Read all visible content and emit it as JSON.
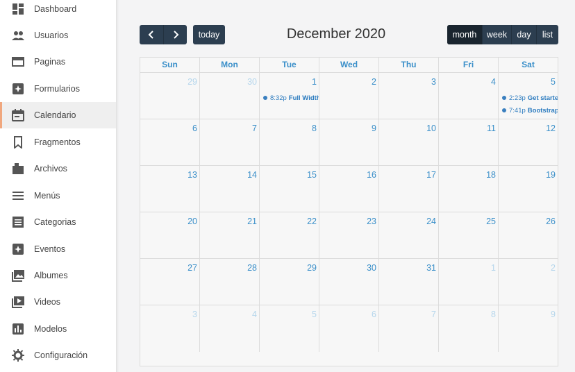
{
  "sidebar": {
    "items": [
      {
        "label": "Dashboard",
        "icon": "dashboard-icon"
      },
      {
        "label": "Usuarios",
        "icon": "users-icon"
      },
      {
        "label": "Paginas",
        "icon": "page-icon"
      },
      {
        "label": "Formularios",
        "icon": "form-icon"
      },
      {
        "label": "Calendario",
        "icon": "calendar-icon",
        "active": true
      },
      {
        "label": "Fragmentos",
        "icon": "bookmark-icon"
      },
      {
        "label": "Archivos",
        "icon": "folder-icon"
      },
      {
        "label": "Menús",
        "icon": "menu-icon"
      },
      {
        "label": "Categorias",
        "icon": "category-icon"
      },
      {
        "label": "Eventos",
        "icon": "event-icon"
      },
      {
        "label": "Albumes",
        "icon": "album-icon"
      },
      {
        "label": "Videos",
        "icon": "video-icon"
      },
      {
        "label": "Modelos",
        "icon": "chart-icon"
      },
      {
        "label": "Configuración",
        "icon": "gear-icon"
      }
    ]
  },
  "calendar": {
    "title": "December 2020",
    "today_label": "today",
    "prev_icon": "chevron-left-icon",
    "next_icon": "chevron-right-icon",
    "views": [
      {
        "label": "month",
        "active": true
      },
      {
        "label": "week"
      },
      {
        "label": "day"
      },
      {
        "label": "list"
      }
    ],
    "weekdays": [
      "Sun",
      "Mon",
      "Tue",
      "Wed",
      "Thu",
      "Fri",
      "Sat"
    ],
    "weeks": [
      [
        "29",
        "30",
        "1",
        "2",
        "3",
        "4",
        "5"
      ],
      [
        "6",
        "7",
        "8",
        "9",
        "10",
        "11",
        "12"
      ],
      [
        "13",
        "14",
        "15",
        "16",
        "17",
        "18",
        "19"
      ],
      [
        "20",
        "21",
        "22",
        "23",
        "24",
        "25",
        "26"
      ],
      [
        "27",
        "28",
        "29",
        "30",
        "31",
        "1",
        "2"
      ],
      [
        "3",
        "4",
        "5",
        "6",
        "7",
        "8",
        "9"
      ]
    ],
    "other_month": [
      [
        true,
        true,
        false,
        false,
        false,
        false,
        false
      ],
      [
        false,
        false,
        false,
        false,
        false,
        false,
        false
      ],
      [
        false,
        false,
        false,
        false,
        false,
        false,
        false
      ],
      [
        false,
        false,
        false,
        false,
        false,
        false,
        false
      ],
      [
        false,
        false,
        false,
        false,
        false,
        true,
        true
      ],
      [
        true,
        true,
        true,
        true,
        true,
        true,
        true
      ]
    ],
    "events": [
      {
        "week": 0,
        "day": 2,
        "time": "8:32p",
        "title": "Full Width"
      },
      {
        "week": 0,
        "day": 6,
        "time": "2:23p",
        "title": "Get started"
      },
      {
        "week": 0,
        "day": 6,
        "time": "7:41p",
        "title": "Bootstrap"
      }
    ]
  },
  "colors": {
    "accent": "#3a8fc9",
    "button_bg": "#2c3e50",
    "active_marker": "#f0a77e"
  }
}
